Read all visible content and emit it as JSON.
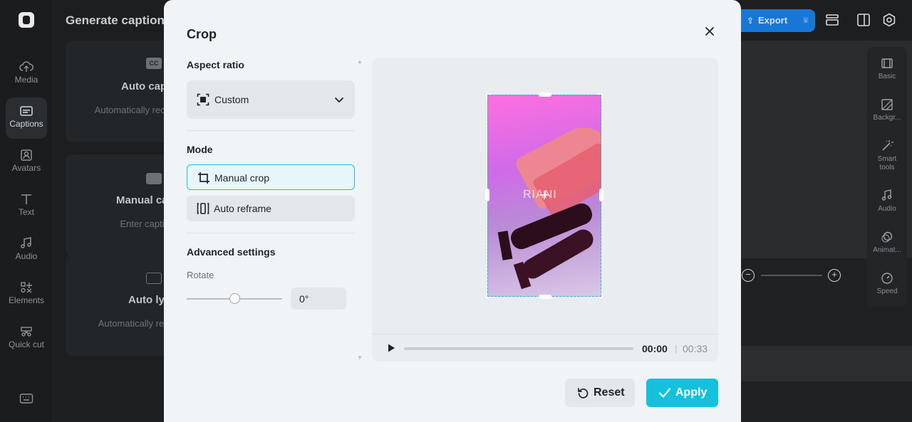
{
  "background": {
    "panel_title": "Generate captions",
    "rail": [
      {
        "label": "Media",
        "icon": "cloud-upload-icon"
      },
      {
        "label": "Captions",
        "icon": "captions-icon"
      },
      {
        "label": "Avatars",
        "icon": "avatar-icon"
      },
      {
        "label": "Text",
        "icon": "text-icon"
      },
      {
        "label": "Audio",
        "icon": "music-note-icon"
      },
      {
        "label": "Elements",
        "icon": "elements-icon"
      },
      {
        "label": "Quick cut",
        "icon": "scissors-icon"
      }
    ],
    "cards": [
      {
        "title": "Auto cap",
        "desc": "Automatically recog videos",
        "icon_text": "CC"
      },
      {
        "title": "Manual ca",
        "desc": "Enter captions",
        "icon_text": ""
      },
      {
        "title": "Auto lyr",
        "desc": "Automatically reco songs",
        "icon_text": ""
      }
    ],
    "export_label": "Export",
    "props": [
      {
        "label": "Basic"
      },
      {
        "label": "Backgr..."
      },
      {
        "label": "Smart tools"
      },
      {
        "label": "Audio"
      },
      {
        "label": "Animat..."
      },
      {
        "label": "Speed"
      }
    ]
  },
  "modal": {
    "title": "Crop",
    "aspect_ratio": {
      "heading": "Aspect ratio",
      "value": "Custom"
    },
    "mode": {
      "heading": "Mode",
      "options": [
        {
          "label": "Manual crop",
          "selected": true
        },
        {
          "label": "Auto reframe",
          "selected": false
        }
      ]
    },
    "advanced": {
      "heading": "Advanced settings",
      "rotate_label": "Rotate",
      "rotate_value": "0°"
    },
    "preview": {
      "watermark_text": "RIANI",
      "time_current": "00:00",
      "time_total": "00:33"
    },
    "buttons": {
      "reset": "Reset",
      "apply": "Apply"
    },
    "colors": {
      "accent": "#13c1dd",
      "crop_border": "#19b8d8"
    }
  }
}
